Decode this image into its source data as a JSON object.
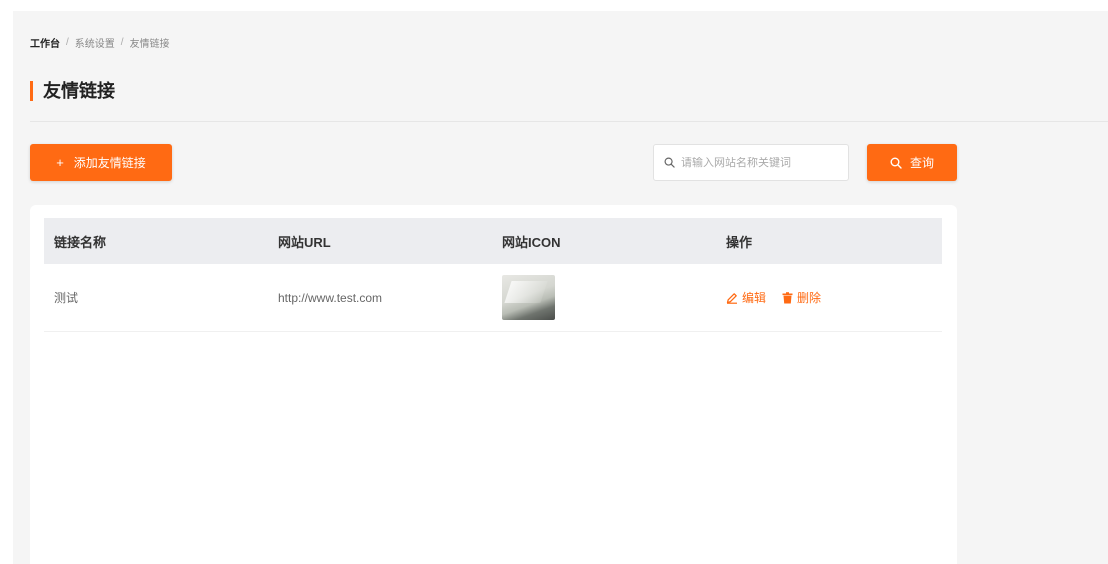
{
  "breadcrumb": {
    "items": [
      "工作台",
      "系统设置",
      "友情链接"
    ],
    "separator": "/"
  },
  "page": {
    "title": "友情链接",
    "accent_color": "#ff6a13"
  },
  "toolbar": {
    "add_label": "添加友情链接",
    "add_icon": "plus-icon",
    "search_placeholder": "请输入网站名称关键词",
    "search_value": "",
    "query_label": "查询",
    "query_icon": "search-icon"
  },
  "table": {
    "columns": [
      "链接名称",
      "网站URL",
      "网站ICON",
      "操作"
    ],
    "rows": [
      {
        "name": "测试",
        "url": "http://www.test.com",
        "icon": "website-icon-thumbnail",
        "actions": {
          "edit": "编辑",
          "delete": "删除"
        }
      }
    ]
  }
}
